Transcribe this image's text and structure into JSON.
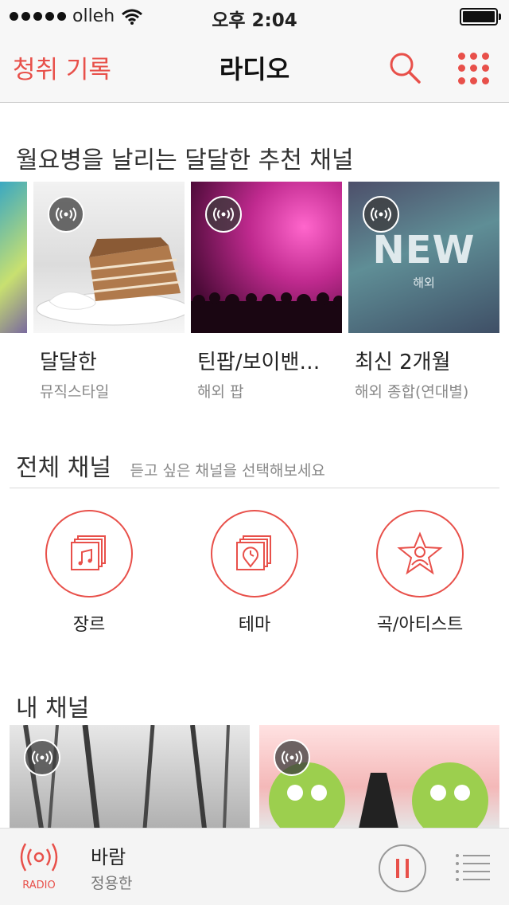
{
  "status": {
    "carrier": "olleh",
    "time": "오후 2:04"
  },
  "nav": {
    "back_label": "청취 기록",
    "title": "라디오"
  },
  "recommended": {
    "title": "월요병을 날리는 달달한 추천 채널",
    "items": [
      {
        "title": "달달한",
        "subtitle": "뮤직스타일"
      },
      {
        "title": "틴팝/보이밴…",
        "subtitle": "해외 팝"
      },
      {
        "title": "최신 2개월",
        "subtitle": "해외 종합(연대별)",
        "badge_text": "NEW",
        "badge_sub": "해외"
      }
    ]
  },
  "all_channels": {
    "title": "전체 채널",
    "hint": "듣고 싶은 채널을 선택해보세요",
    "categories": [
      {
        "label": "장르",
        "icon": "music-note-icon"
      },
      {
        "label": "테마",
        "icon": "clock-pin-icon"
      },
      {
        "label": "곡/아티스트",
        "icon": "star-person-icon"
      }
    ]
  },
  "my_channels": {
    "title": "내 채널"
  },
  "player": {
    "label": "RADIO",
    "title": "바람",
    "artist": "정용한"
  },
  "colors": {
    "accent": "#e8504a"
  }
}
